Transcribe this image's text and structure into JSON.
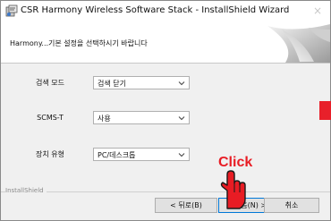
{
  "window": {
    "title": "CSR Harmony Wireless Software Stack - InstallShield Wizard",
    "close_glyph": "×"
  },
  "header": {
    "text": "Harmony...기본 설정을 선택하시기 바랍니다"
  },
  "fields": [
    {
      "label": "검색 모드",
      "value": "검색 닫기"
    },
    {
      "label": "SCMS-T",
      "value": "사용"
    },
    {
      "label": "장치 유형",
      "value": "PC/데스크톱"
    }
  ],
  "annotation": {
    "click_text": "Click"
  },
  "footer": {
    "brand": "InstallShield",
    "back_label": "< 뒤로(B)",
    "next_label": "다음(N) >",
    "cancel_label": "취소"
  },
  "colors": {
    "annotation_red": "#e81c24",
    "marker_red": "#e8202a"
  }
}
